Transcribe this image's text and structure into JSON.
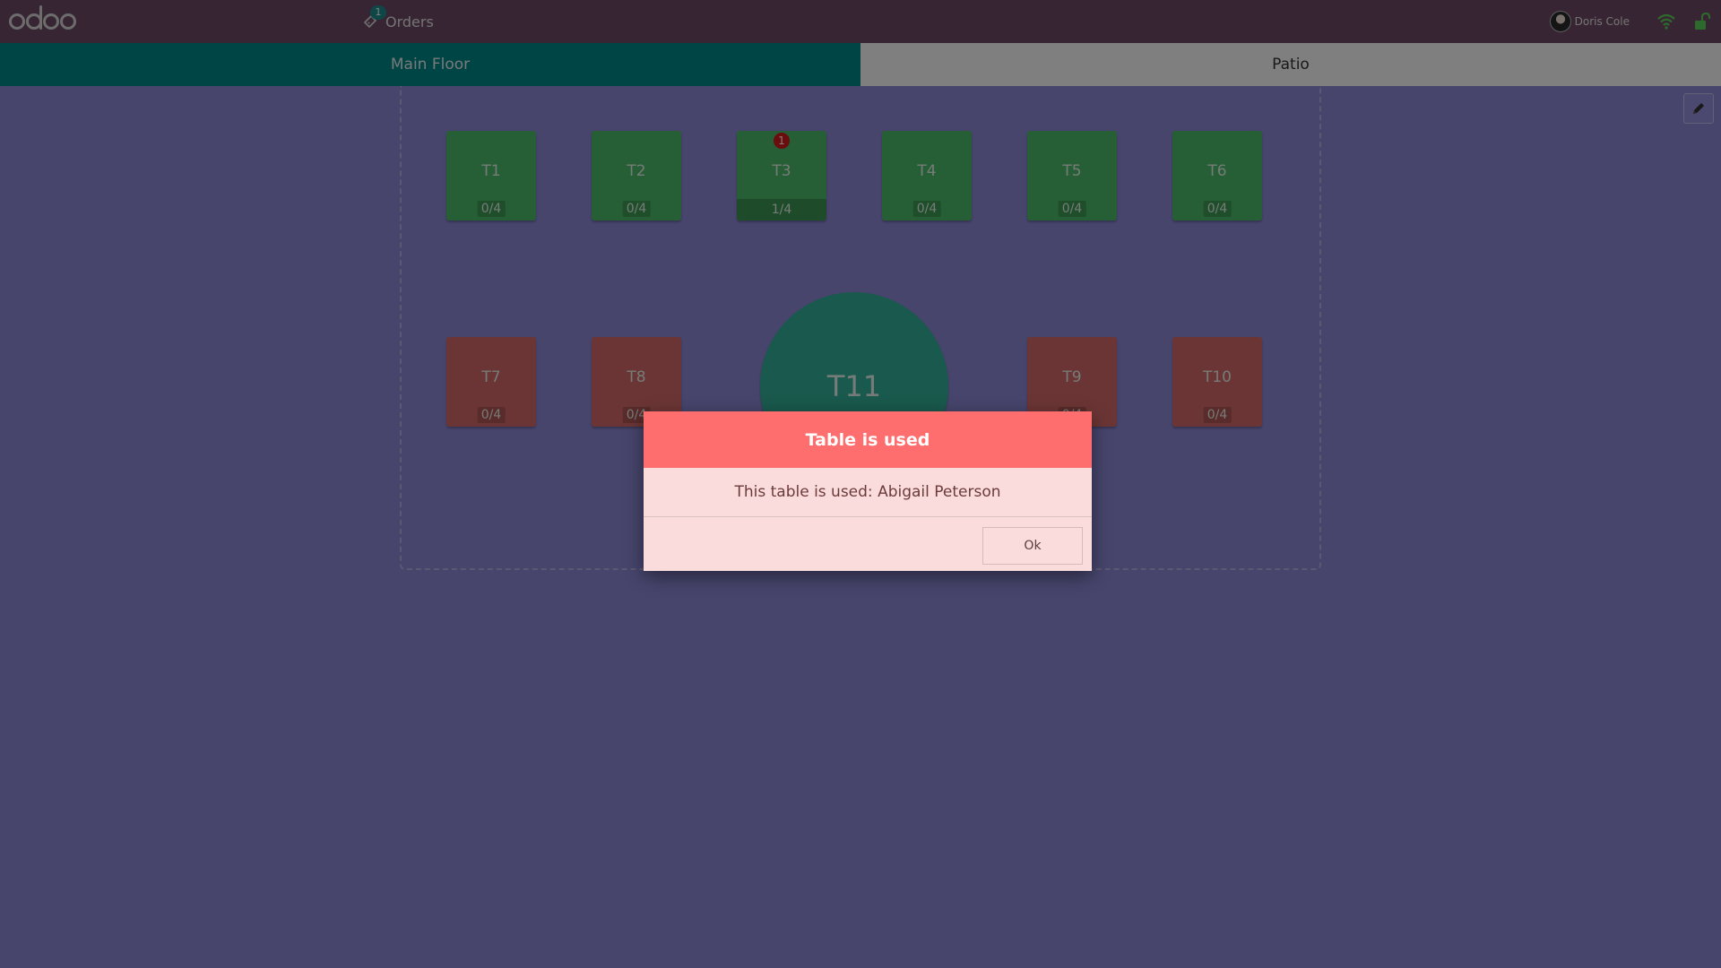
{
  "navbar": {
    "orders_label": "Orders",
    "orders_count": "1",
    "user_name": "Doris Cole"
  },
  "floors": [
    {
      "label": "Main Floor",
      "active": true
    },
    {
      "label": "Patio",
      "active": false
    }
  ],
  "tables": [
    {
      "name": "T1",
      "seats": "0/4",
      "status": "green"
    },
    {
      "name": "T2",
      "seats": "0/4",
      "status": "green"
    },
    {
      "name": "T3",
      "seats": "1/4",
      "status": "green",
      "orders": "1"
    },
    {
      "name": "T4",
      "seats": "0/4",
      "status": "green"
    },
    {
      "name": "T5",
      "seats": "0/4",
      "status": "green"
    },
    {
      "name": "T6",
      "seats": "0/4",
      "status": "green"
    },
    {
      "name": "T7",
      "seats": "0/4",
      "status": "red"
    },
    {
      "name": "T8",
      "seats": "0/4",
      "status": "red"
    },
    {
      "name": "T11",
      "status": "round"
    },
    {
      "name": "T9",
      "seats": "0/4",
      "status": "red"
    },
    {
      "name": "T10",
      "seats": "0/4",
      "status": "red"
    }
  ],
  "dialog": {
    "title": "Table is used",
    "message": "This table is used: Abigail Peterson",
    "ok_label": "Ok"
  },
  "colors": {
    "navbar": "#714b67",
    "floor_active": "#008b8b",
    "floor_bg": "#8e8ad9",
    "table_free": "#4dbf6b",
    "table_used": "#d96a6a",
    "table_round": "#35b39b",
    "dialog_header": "#ff6e6e"
  }
}
